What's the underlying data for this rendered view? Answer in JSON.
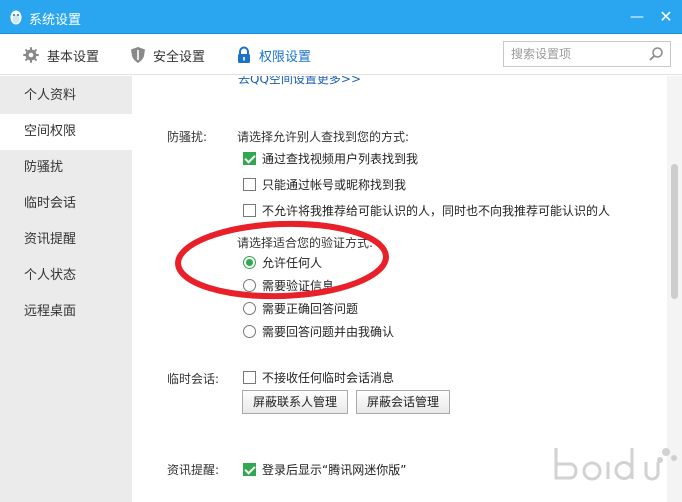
{
  "window": {
    "title": "系统设置",
    "minimize_glyph": "—",
    "close_glyph": "✕",
    "app_icon": "penguin-icon"
  },
  "toolbar": {
    "tabs": [
      {
        "label": "基本设置",
        "icon": "gear-icon"
      },
      {
        "label": "安全设置",
        "icon": "shield-icon"
      },
      {
        "label": "权限设置",
        "icon": "lock-icon",
        "active": true
      }
    ],
    "search_placeholder": "搜索设置项"
  },
  "sidebar": {
    "items": [
      {
        "label": "个人资料"
      },
      {
        "label": "空间权限",
        "active": true
      },
      {
        "label": "防骚扰"
      },
      {
        "label": "临时会话"
      },
      {
        "label": "资讯提醒"
      },
      {
        "label": "个人状态"
      },
      {
        "label": "远程桌面"
      }
    ]
  },
  "content": {
    "partial_link": "去QQ空间设置更多>>",
    "anti_harass": {
      "label": "防骚扰:",
      "find_prompt": "请选择允许别人查找到您的方式:",
      "find_options": [
        {
          "label": "通过查找视频用户列表找到我",
          "checked": true
        },
        {
          "label": "只能通过帐号或昵称找到我",
          "checked": false
        },
        {
          "label": "不允许将我推荐给可能认识的人，同时也不向我推荐可能认识的人",
          "checked": false
        }
      ],
      "verify_prompt": "请选择适合您的验证方式:",
      "verify_options": [
        {
          "label": "允许任何人",
          "checked": true
        },
        {
          "label": "需要验证信息",
          "checked": false
        },
        {
          "label": "需要正确回答问题",
          "checked": false
        },
        {
          "label": "需要回答问题并由我确认",
          "checked": false
        }
      ]
    },
    "temp_session": {
      "label": "临时会话:",
      "option": {
        "label": "不接收任何临时会话消息",
        "checked": false
      },
      "buttons": [
        "屏蔽联系人管理",
        "屏蔽会话管理"
      ]
    },
    "news": {
      "label": "资讯提醒:",
      "option": {
        "label": "登录后显示“腾讯网迷你版”",
        "checked": true
      }
    }
  },
  "colors": {
    "titlebar": "#29a6ef",
    "accent": "#1a72c9",
    "check": "#2fa84f",
    "annotation": "#e8202a"
  }
}
